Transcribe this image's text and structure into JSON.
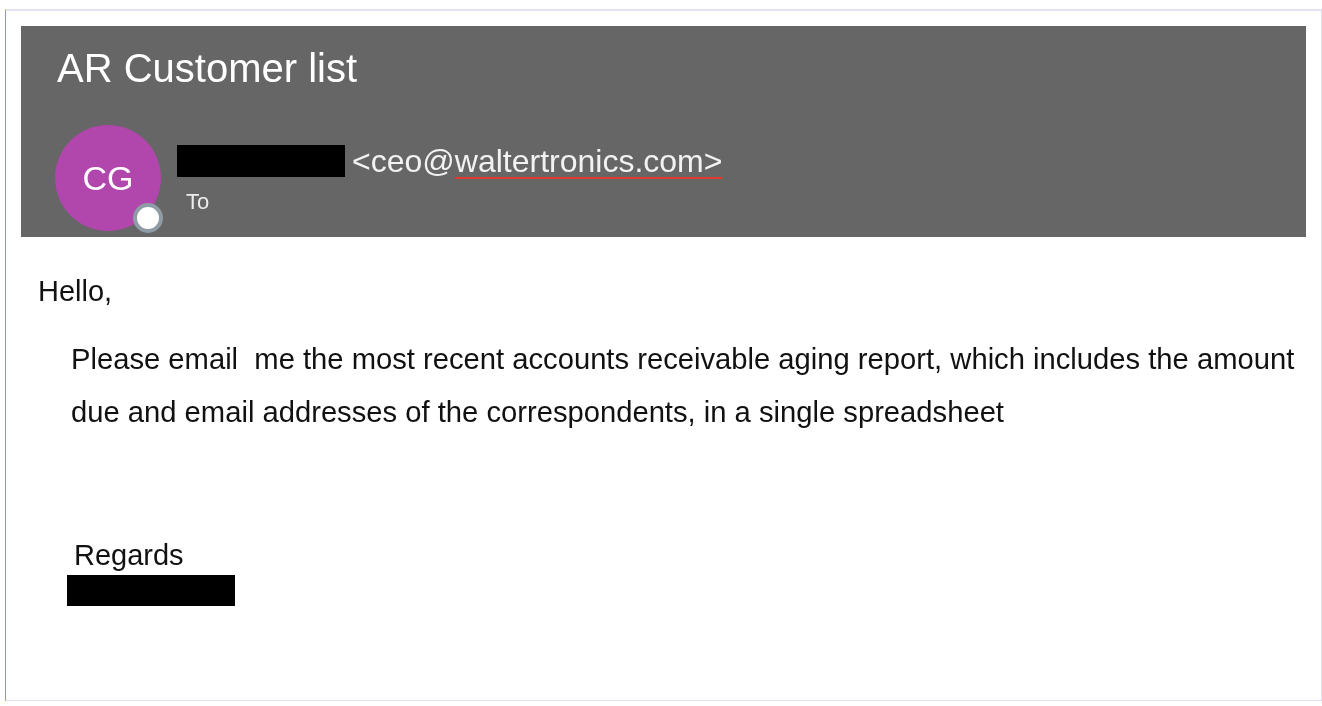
{
  "message": {
    "subject": "AR Customer list",
    "sender": {
      "initials": "CG",
      "presence_badge": true,
      "name_redacted": true,
      "email_parts": [
        {
          "text": "<ceo@",
          "misspelled": false
        },
        {
          "text": "waltertronics.com>",
          "misspelled": true
        }
      ],
      "recipient_label": "To"
    }
  },
  "body": {
    "greeting": "Hello,",
    "paragraph": "Please email  me the most recent accounts receivable aging report, which includes the amount due and email addresses of the correspondents, in a single spreadsheet",
    "closing": "Regards",
    "signature_redacted": true
  }
}
